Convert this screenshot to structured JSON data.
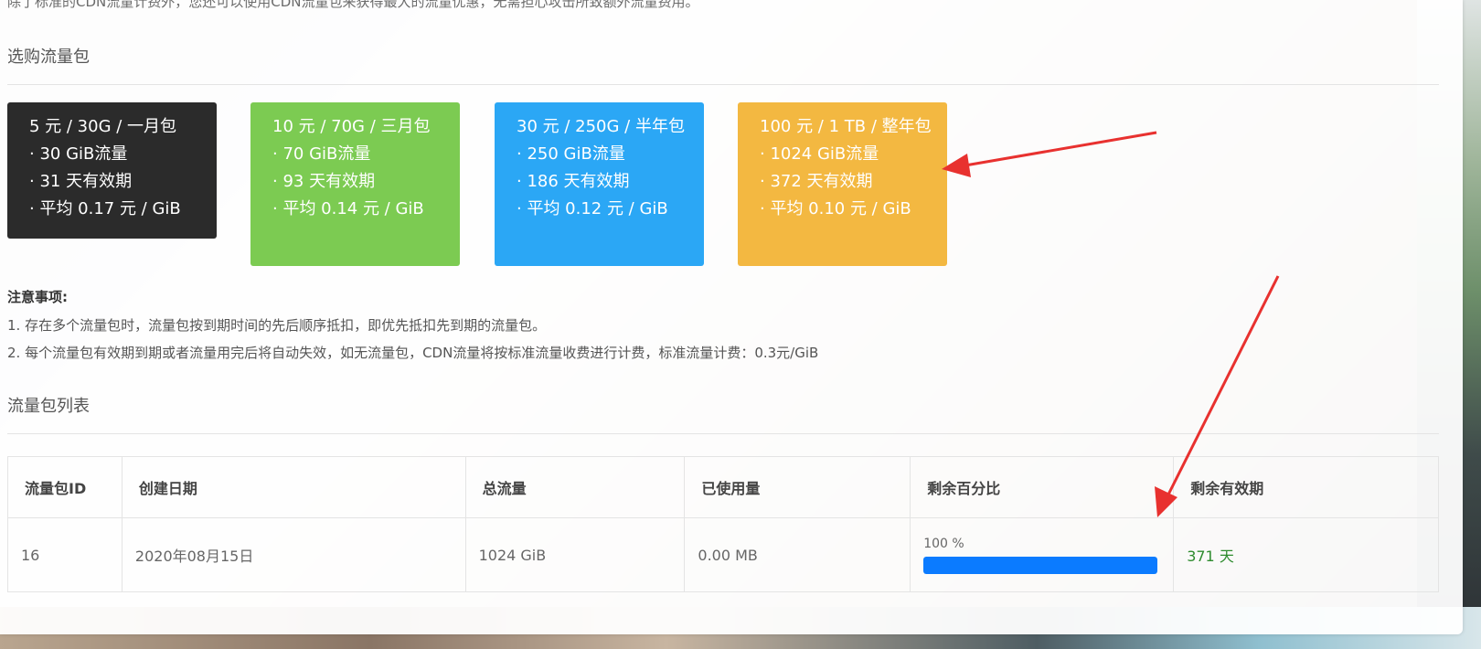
{
  "intro_text": "除了标准的CDN流量计费外，您还可以使用CDN流量包来获得最大的流量优惠，无需担心攻击所致额外流量费用。",
  "shop": {
    "title": "选购流量包",
    "packages": [
      {
        "lines": [
          "5 元 / 30G / 一月包",
          "· 30 GiB流量",
          "· 31 天有效期",
          "· 平均 0.17 元 / GiB"
        ],
        "color": "#2b2b2b"
      },
      {
        "lines": [
          "10 元 / 70G / 三月包",
          "· 70 GiB流量",
          "· 93 天有效期",
          "· 平均 0.14 元 / GiB"
        ],
        "color": "#7ccb52"
      },
      {
        "lines": [
          "30 元 / 250G / 半年包",
          "· 250 GiB流量",
          "· 186 天有效期",
          "· 平均 0.12 元 / GiB"
        ],
        "color": "#2ba7f5"
      },
      {
        "lines": [
          "100 元 / 1 TB / 整年包",
          "· 1024 GiB流量",
          "· 372 天有效期",
          "· 平均 0.10 元 / GiB"
        ],
        "color": "#f3b841"
      }
    ]
  },
  "notes": {
    "title": "注意事项:",
    "items": [
      "1. 存在多个流量包时，流量包按到期时间的先后顺序抵扣，即优先抵扣先到期的流量包。",
      "2. 每个流量包有效期到期或者流量用完后将自动失效，如无流量包，CDN流量将按标准流量收费进行计费，标准流量计费：0.3元/GiB"
    ]
  },
  "list": {
    "title": "流量包列表",
    "headers": [
      "流量包ID",
      "创建日期",
      "总流量",
      "已使用量",
      "剩余百分比",
      "剩余有效期"
    ],
    "rows": [
      {
        "id": "16",
        "date": "2020年08月15日",
        "total": "1024 GiB",
        "used": "0.00 MB",
        "percent_label": "100 %",
        "percent": 100,
        "remaining": "371 天"
      }
    ]
  },
  "colors": {
    "progress": "#0b7bff",
    "remaining_days": "#2e8b2e",
    "annotation_arrow": "#e8312f"
  }
}
